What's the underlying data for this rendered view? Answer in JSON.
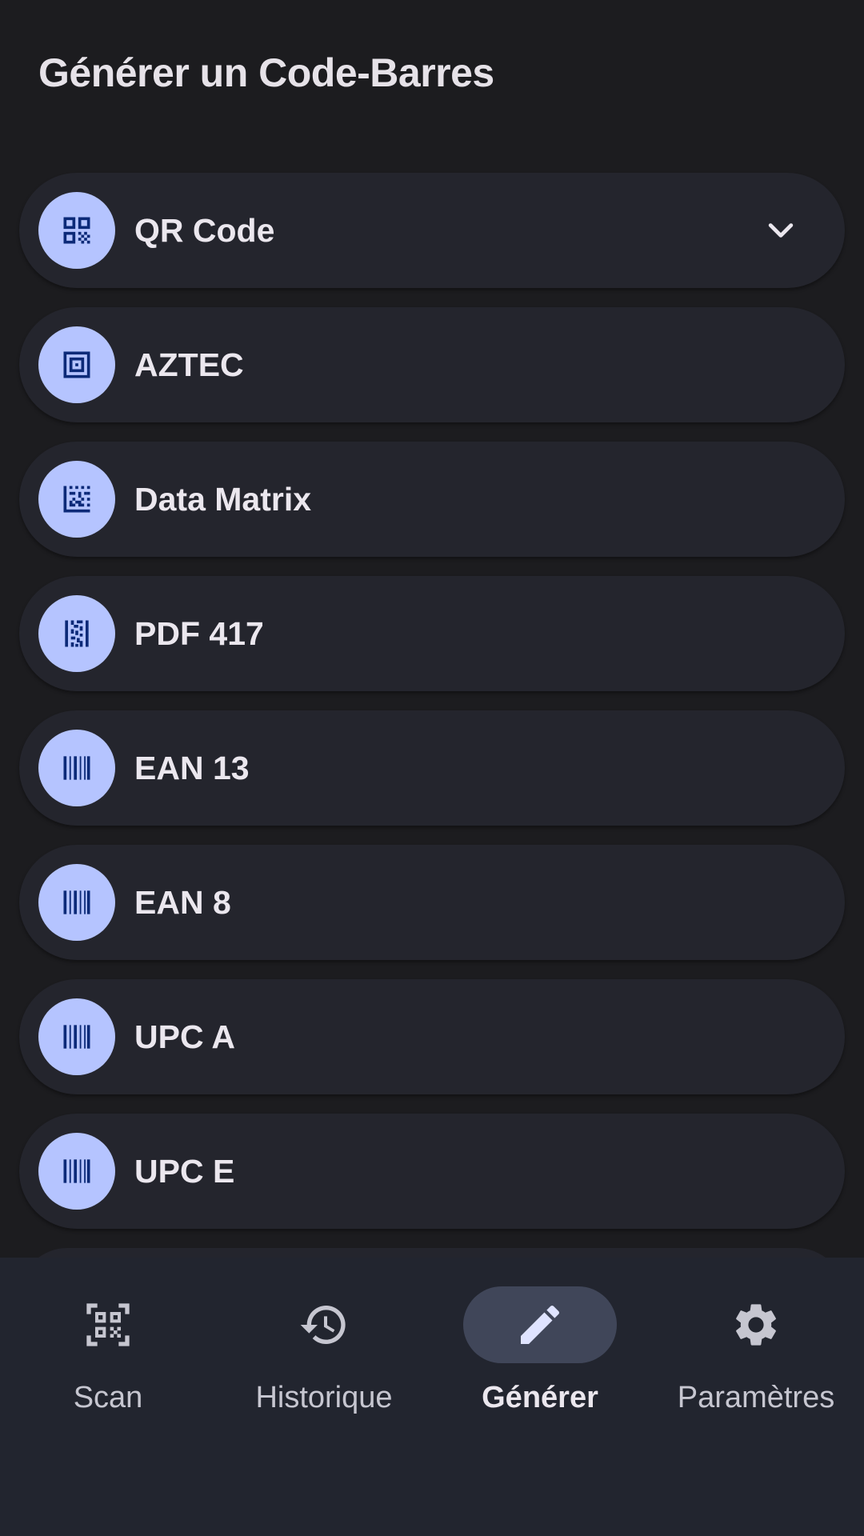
{
  "header": {
    "title": "Générer un Code-Barres"
  },
  "barcode_types": [
    {
      "label": "QR Code",
      "icon": "qr-code-icon",
      "expandable": true
    },
    {
      "label": "AZTEC",
      "icon": "aztec-icon"
    },
    {
      "label": "Data Matrix",
      "icon": "data-matrix-icon"
    },
    {
      "label": "PDF 417",
      "icon": "pdf417-icon"
    },
    {
      "label": "EAN 13",
      "icon": "barcode-icon"
    },
    {
      "label": "EAN 8",
      "icon": "barcode-icon"
    },
    {
      "label": "UPC A",
      "icon": "barcode-icon"
    },
    {
      "label": "UPC E",
      "icon": "barcode-icon"
    }
  ],
  "bottom_nav": [
    {
      "label": "Scan",
      "icon": "qr-scan-icon",
      "active": false
    },
    {
      "label": "Historique",
      "icon": "history-icon",
      "active": false
    },
    {
      "label": "Générer",
      "icon": "edit-pencil-icon",
      "active": true
    },
    {
      "label": "Paramètres",
      "icon": "gear-icon",
      "active": false
    }
  ],
  "colors": {
    "background": "#1c1c1f",
    "card": "#24252d",
    "badge": "#b5c4ff",
    "icon_dark": "#0c2a78",
    "nav_background": "#22252f",
    "nav_active_pill": "#404659"
  }
}
